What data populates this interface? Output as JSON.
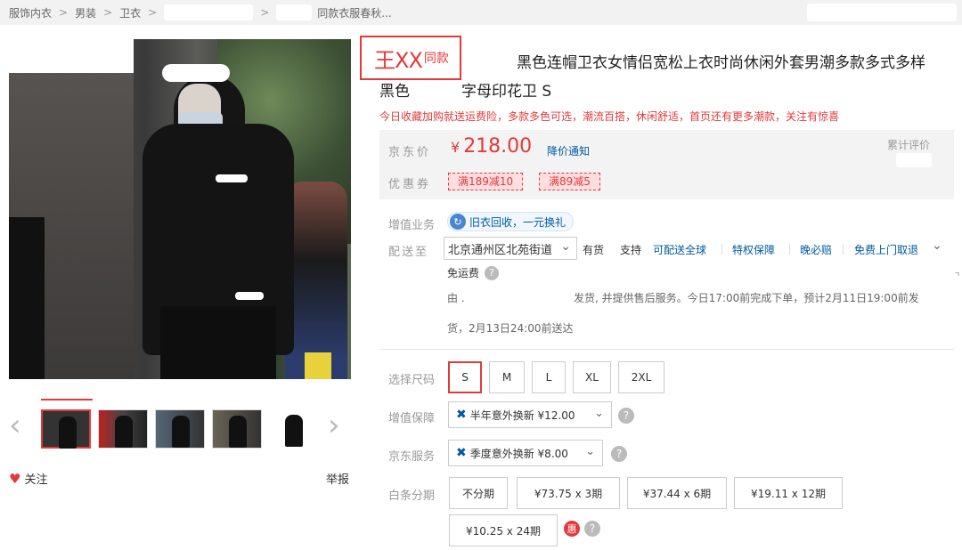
{
  "breadcrumb": {
    "items": [
      "服饰内衣",
      "男装",
      "卫衣"
    ],
    "last": "同款衣服春秋..."
  },
  "gallery": {
    "zoom_icon": "search-icon",
    "thumbnail_count": 5,
    "follow_label": "关注",
    "report_label": "举报"
  },
  "product": {
    "same_style_big": "王XX",
    "same_style_small": "同款",
    "title_line1": "黑色连帽卫衣女情侣宽松上衣时尚休闲外套男潮多款多式多样",
    "title_line2a": "黑色",
    "title_line2b": "字母印花卫 S",
    "promo_text": "今日收藏加购就送运费险，多款多色可选，潮流百搭，休闲舒适，首页还有更多潮款，关注有惊喜"
  },
  "price_box": {
    "price_label": "京东价",
    "currency": "¥",
    "price": "218.00",
    "notify": "降价通知",
    "review_label": "累计评价",
    "coupon_label": "优惠券",
    "coupons": [
      "满189减10",
      "满89减5"
    ]
  },
  "service": {
    "label": "增值业务",
    "pill": "旧衣回收，一元换礼"
  },
  "delivery": {
    "label": "配送至",
    "address": "北京通州区北苑街道",
    "stock": "有货",
    "support": "支持",
    "tags": [
      "可配送全球",
      "特权保障",
      "晚必赔",
      "免费上门取退"
    ],
    "free_shipping": "免运费",
    "ship_by": "由 .",
    "ship_text_1": "发货, 并提供售后服务。今日17:00前完成下单，预计2月11日19:00前发",
    "ship_text_2": "货，2月13日24:00前送达"
  },
  "size": {
    "label": "选择尺码",
    "options": [
      "S",
      "M",
      "L",
      "XL",
      "2XL"
    ],
    "selected": "S"
  },
  "protection": {
    "label": "增值保障",
    "value": "半年意外换新 ¥12.00"
  },
  "jd_service": {
    "label": "京东服务",
    "value": "季度意外换新 ¥8.00"
  },
  "installments": {
    "label": "白条分期",
    "options": [
      "不分期",
      "¥73.75 x 3期",
      "¥37.44 x 6期",
      "¥19.11 x 12期",
      "¥10.25 x 24期"
    ],
    "hui_badge": "惠"
  },
  "colors": {
    "accent": "#e4393c",
    "link": "#005aa0",
    "price_bg": "#f3f3f3"
  }
}
